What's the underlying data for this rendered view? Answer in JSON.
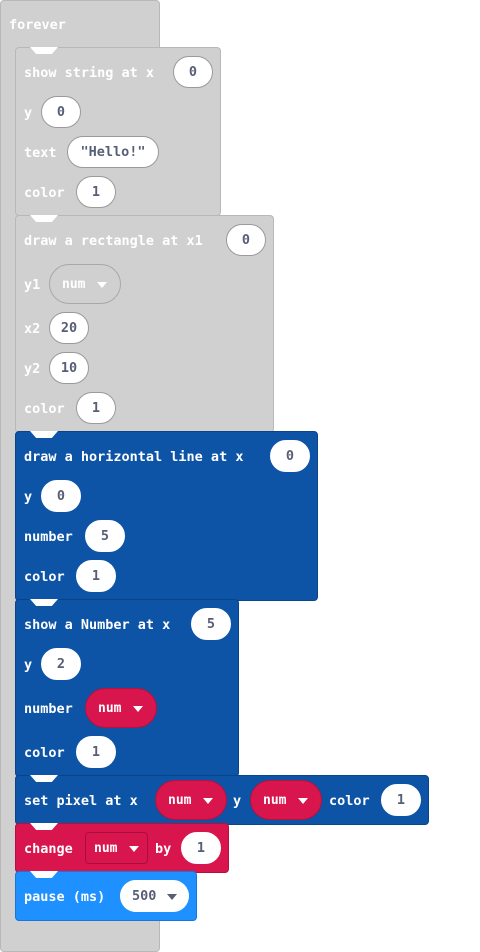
{
  "forever": {
    "label": "forever"
  },
  "show_string": {
    "label": "show string at x",
    "x": "0",
    "y_label": "y",
    "y": "0",
    "text_label": "text",
    "text": "\"Hello!\"",
    "color_label": "color",
    "color": "1"
  },
  "draw_rect": {
    "label": "draw a rectangle at x1",
    "x1": "0",
    "y1_label": "y1",
    "y1_var": "num",
    "x2_label": "x2",
    "x2": "20",
    "y2_label": "y2",
    "y2": "10",
    "color_label": "color",
    "color": "1"
  },
  "hline": {
    "label": "draw a horizontal line at x",
    "x": "0",
    "y_label": "y",
    "y": "0",
    "number_label": "number",
    "number": "5",
    "color_label": "color",
    "color": "1"
  },
  "show_number": {
    "label": "show a Number at x",
    "x": "5",
    "y_label": "y",
    "y": "2",
    "number_label": "number",
    "number_var": "num",
    "color_label": "color",
    "color": "1"
  },
  "set_pixel": {
    "label": "set pixel at x",
    "x_var": "num",
    "y_label": "y",
    "y_var": "num",
    "color_label": "color",
    "color": "1"
  },
  "change": {
    "label": "change",
    "var": "num",
    "by_label": "by",
    "value": "1"
  },
  "pause": {
    "label": "pause (ms)",
    "value": "500"
  },
  "colors": {
    "grey_block": "#d0d0d0",
    "display_blue": "#0d53a6",
    "variables_red": "#d9154d",
    "basic_blue": "#1e90ff"
  }
}
